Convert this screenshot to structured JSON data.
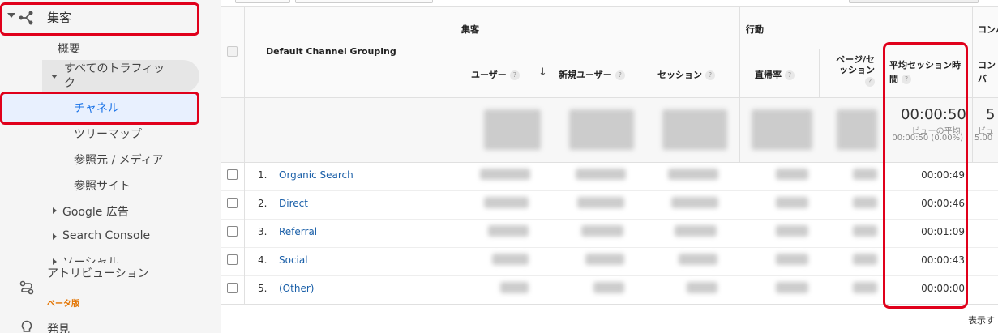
{
  "sidebar": {
    "acquisition": "集客",
    "overview": "概要",
    "all_traffic": "すべてのトラフィック",
    "channels": "チャネル",
    "treemap": "ツリーマップ",
    "source_medium": "参照元 / メディア",
    "referrals": "参照サイト",
    "google_ads": "Google 広告",
    "search_console": "Search Console",
    "social": "ソーシャル",
    "attribution": "アトリビューション",
    "beta": "ベータ版",
    "discover": "発見"
  },
  "table": {
    "dimension_header": "Default Channel Grouping",
    "groups": {
      "acquisition": "集客",
      "behavior": "行動",
      "conversions": "コンバ"
    },
    "columns": {
      "users": "ユーザー",
      "new_users": "新規ユーザー",
      "sessions": "セッション",
      "bounce_rate": "直帰率",
      "pages_per_session": "ページ/セッション",
      "avg_session_duration": "平均セッション時間",
      "conversion_partial": "コンバ ン率"
    },
    "help_glyph": "?",
    "sort_arrow": "↓",
    "totals": {
      "avg_session_duration": "00:00:50",
      "view_avg_label": "ビューの平均:",
      "view_avg_value": "00:00:50 (0.00%)",
      "conv_partial": "5",
      "conv_sub_label": "ビュ",
      "conv_sub_value": "5.00"
    },
    "rows": [
      {
        "num": "1.",
        "channel": "Organic Search",
        "avg_session_duration": "00:00:49"
      },
      {
        "num": "2.",
        "channel": "Direct",
        "avg_session_duration": "00:00:46"
      },
      {
        "num": "3.",
        "channel": "Referral",
        "avg_session_duration": "00:01:09"
      },
      {
        "num": "4.",
        "channel": "Social",
        "avg_session_duration": "00:00:43"
      },
      {
        "num": "5.",
        "channel": "(Other)",
        "avg_session_duration": "00:00:00"
      }
    ],
    "footer_text": "表示す"
  },
  "colors": {
    "highlight": "#e0001b",
    "link": "#1a5fa8",
    "active_nav": "#1a73e8",
    "beta": "#e37400"
  }
}
